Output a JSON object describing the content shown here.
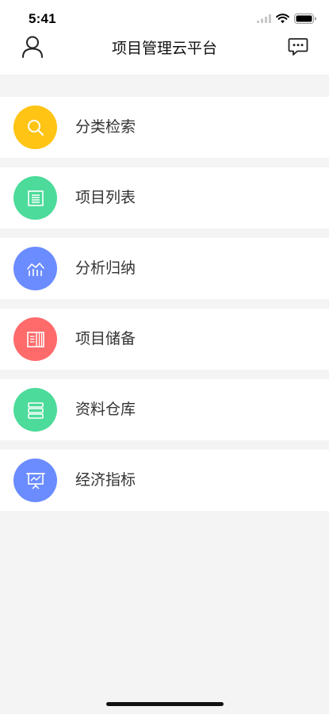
{
  "status_bar": {
    "time": "5:41",
    "icons": [
      "signal-icon",
      "wifi-icon",
      "battery-icon"
    ]
  },
  "header": {
    "title": "项目管理云平台",
    "left_icon": "user-icon",
    "right_icon": "message-icon"
  },
  "menu": {
    "items": [
      {
        "label": "分类检索",
        "icon": "search-icon",
        "color": "#ffc414"
      },
      {
        "label": "项目列表",
        "icon": "list-icon",
        "color": "#4cdb9a"
      },
      {
        "label": "分析归纳",
        "icon": "analysis-chart-icon",
        "color": "#6b8cff"
      },
      {
        "label": "项目储备",
        "icon": "book-icon",
        "color": "#ff6b6b"
      },
      {
        "label": "资料仓库",
        "icon": "storage-icon",
        "color": "#4cdb9a"
      },
      {
        "label": "经济指标",
        "icon": "presentation-icon",
        "color": "#6b8cff"
      }
    ]
  }
}
